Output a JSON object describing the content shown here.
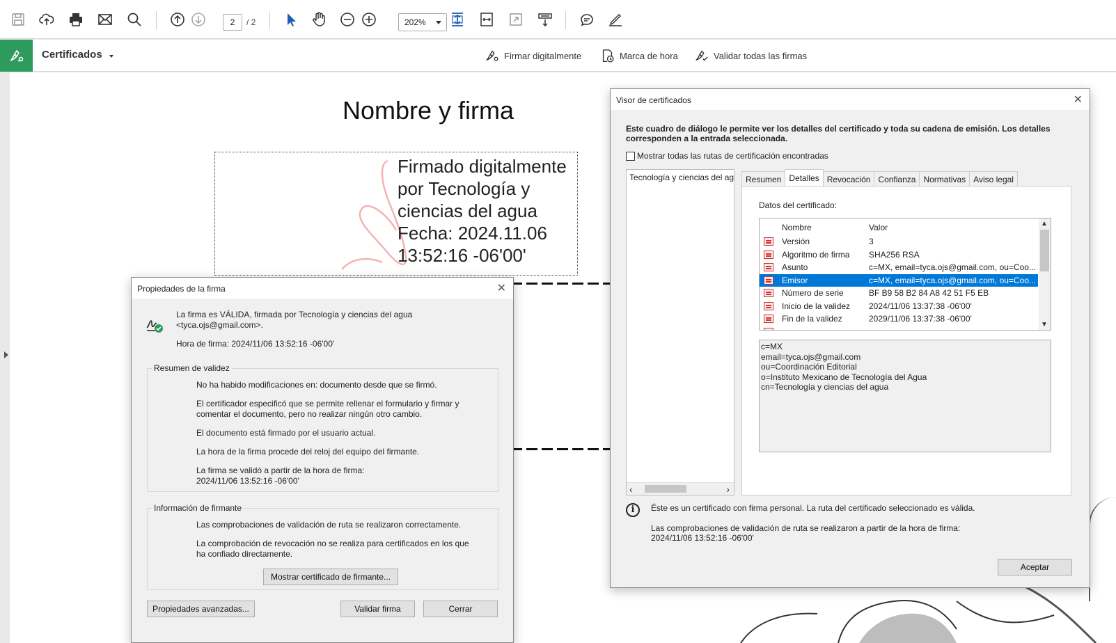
{
  "toolbar": {
    "page_current": "2",
    "page_total": "/ 2",
    "zoom": "202%",
    "icons": [
      "save-icon",
      "upload-icon",
      "print-icon",
      "mail-icon",
      "search-icon",
      "page-up-icon",
      "page-down-icon",
      "select-arrow-icon",
      "hand-tool-icon",
      "zoom-out-icon",
      "zoom-in-icon",
      "fit-page-icon",
      "fit-width-icon",
      "fullscreen-icon",
      "read-mode-icon",
      "comment-icon",
      "sign-pen-icon"
    ]
  },
  "certbar": {
    "title": "Certificados",
    "buttons": [
      "Firmar digitalmente",
      "Marca de hora",
      "Validar todas las firmas"
    ]
  },
  "document": {
    "heading": "Nombre y firma",
    "signature_lines": [
      "Firmado digitalmente",
      "por Tecnología y",
      "ciencias del agua",
      "Fecha: 2024.11.06",
      "13:52:16 -06'00'"
    ]
  },
  "sigprops": {
    "title": "Propiedades de la firma",
    "status": "La firma es VÁLIDA, firmada por Tecnología y ciencias del agua <tyca.ojs@gmail.com>.",
    "time": "Hora de firma:  2024/11/06 13:52:16 -06'00'",
    "summary_label": "Resumen de validez",
    "summary": [
      "No ha habido modificaciones en: documento desde que se firmó.",
      "El certificador especificó que se permite rellenar el formulario y firmar y comentar el documento, pero no realizar ningún otro cambio.",
      "El documento está firmado por el usuario actual.",
      "La hora de la firma procede del reloj del equipo del firmante.",
      "La firma se validó a partir de la hora de firma:\n2024/11/06 13:52:16 -06'00'"
    ],
    "signer_label": "Información de firmante",
    "signer": [
      "Las comprobaciones de validación de ruta se realizaron correctamente.",
      "La comprobación de revocación no se realiza para certificados en los que ha confiado directamente."
    ],
    "show_cert_button": "Mostrar certificado de firmante...",
    "advanced_button": "Propiedades avanzadas...",
    "validate_button": "Validar firma",
    "close_button": "Cerrar"
  },
  "certviewer": {
    "title": "Visor de certificados",
    "intro": "Este cuadro de diálogo le permite ver los detalles del certificado y toda su cadena de emisión. Los detalles corresponden a la entrada seleccionada.",
    "show_all_paths": "Mostrar todas las rutas de certificación encontradas",
    "chain_item": "Tecnología y ciencias del agu",
    "tabs": [
      "Resumen",
      "Detalles",
      "Revocación",
      "Confianza",
      "Normativas",
      "Aviso legal"
    ],
    "active_tab": "Detalles",
    "data_label": "Datos del certificado:",
    "col_name": "Nombre",
    "col_value": "Valor",
    "rows": [
      {
        "name": "Versión",
        "value": "3"
      },
      {
        "name": "Algoritmo de firma",
        "value": "SHA256 RSA"
      },
      {
        "name": "Asunto",
        "value": "c=MX, email=tyca.ojs@gmail.com, ou=Coo..."
      },
      {
        "name": "Emisor",
        "value": "c=MX, email=tyca.ojs@gmail.com, ou=Coo..."
      },
      {
        "name": "Número de serie",
        "value": "BF B9 58 B2 84 A8 42 51 F5 EB"
      },
      {
        "name": "Inicio de la validez",
        "value": "2024/11/06 13:37:38 -06'00'"
      },
      {
        "name": "Fin de la validez",
        "value": "2029/11/06 13:37:38 -06'00'"
      }
    ],
    "selected_row": "Emisor",
    "detail_lines": [
      "c=MX",
      "email=tyca.ojs@gmail.com",
      "ou=Coordinación Editorial",
      "o=Instituto Mexicano de Tecnología del Agua",
      "cn=Tecnología y ciencias del agua"
    ],
    "info_1": "Éste es un certificado con firma personal. La ruta del certificado seleccionado es válida.",
    "info_2": "Las comprobaciones de validación de ruta se realizaron a partir de la hora de firma:\n2024/11/06 13:52:16 -06'00'",
    "accept_button": "Aceptar"
  },
  "colors": {
    "accent_green": "#2e9a5e",
    "selection_blue": "#0078d7"
  }
}
